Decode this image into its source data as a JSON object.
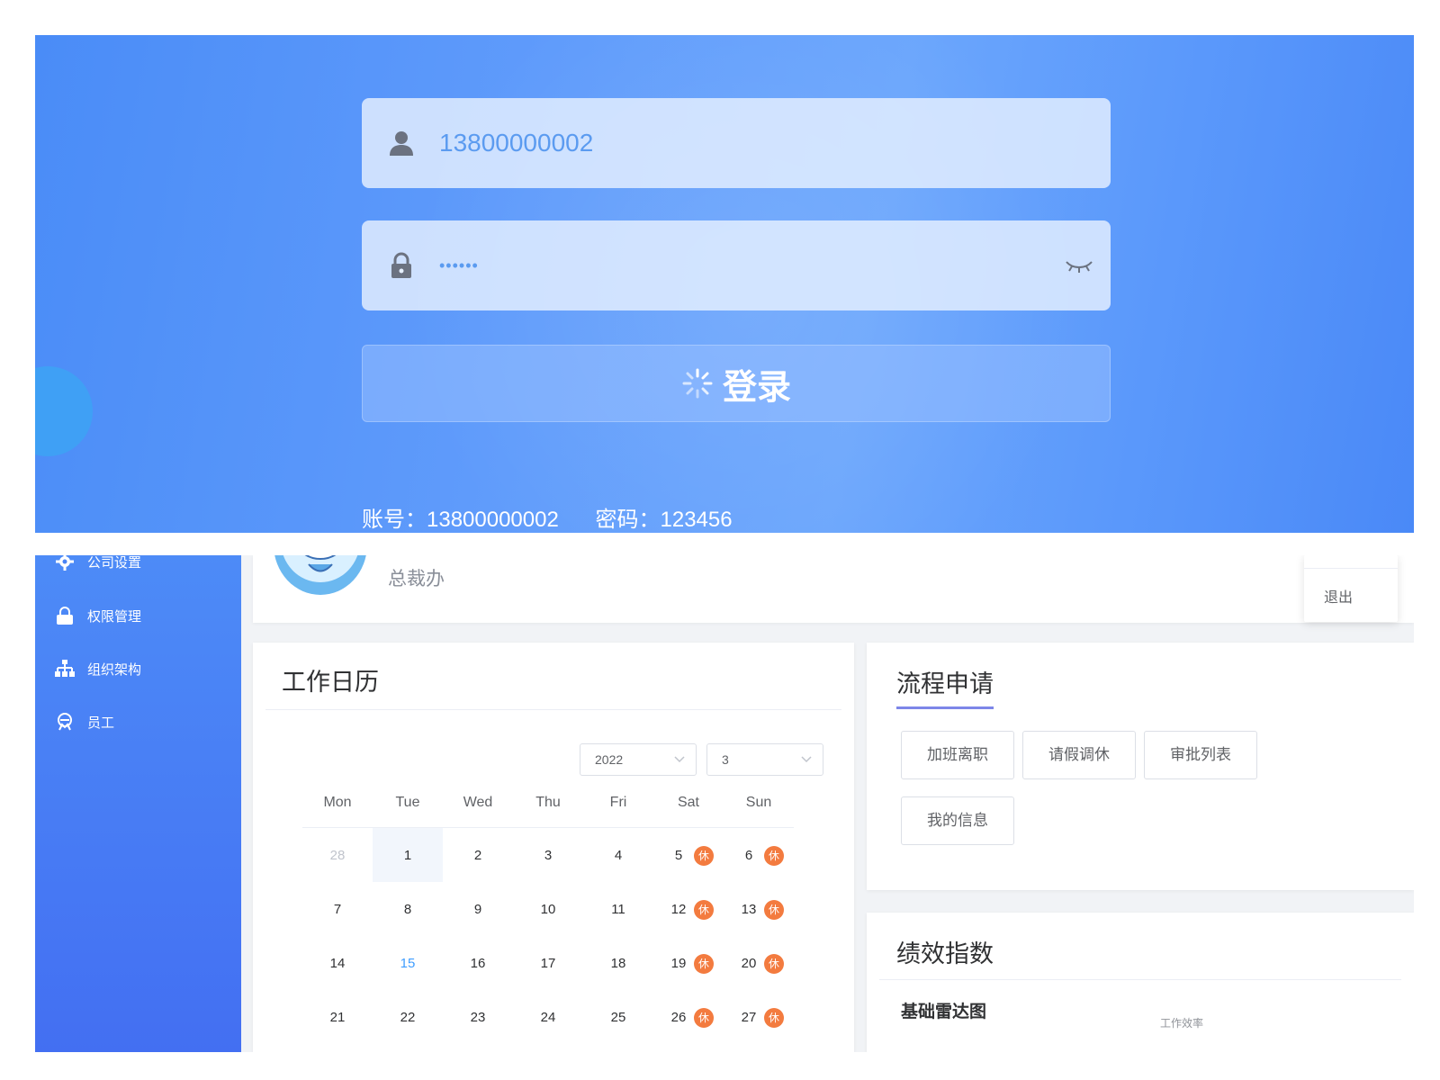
{
  "login": {
    "username_value": "13800000002",
    "password_mask": "••••••",
    "login_button_label": "登录",
    "hint_account": "账号：13800000002",
    "hint_password": "密码：123456"
  },
  "sidebar": {
    "items": [
      {
        "label": "公司设置",
        "icon": "gear-icon"
      },
      {
        "label": "权限管理",
        "icon": "lock-icon"
      },
      {
        "label": "组织架构",
        "icon": "org-chart-icon"
      },
      {
        "label": "员工",
        "icon": "employee-icon"
      }
    ]
  },
  "profile": {
    "department": "总裁办",
    "logout_label": "退出"
  },
  "calendar": {
    "title": "工作日历",
    "year": "2022",
    "month": "3",
    "weekdays": [
      "Mon",
      "Tue",
      "Wed",
      "Thu",
      "Fri",
      "Sat",
      "Sun"
    ],
    "rest_badge": "休",
    "rows": [
      [
        {
          "d": "28",
          "muted": true
        },
        {
          "d": "1",
          "selected": true
        },
        {
          "d": "2"
        },
        {
          "d": "3"
        },
        {
          "d": "4"
        },
        {
          "d": "5",
          "rest": true
        },
        {
          "d": "6",
          "rest": true
        }
      ],
      [
        {
          "d": "7"
        },
        {
          "d": "8"
        },
        {
          "d": "9"
        },
        {
          "d": "10"
        },
        {
          "d": "11"
        },
        {
          "d": "12",
          "rest": true
        },
        {
          "d": "13",
          "rest": true
        }
      ],
      [
        {
          "d": "14"
        },
        {
          "d": "15",
          "today": true
        },
        {
          "d": "16"
        },
        {
          "d": "17"
        },
        {
          "d": "18"
        },
        {
          "d": "19",
          "rest": true
        },
        {
          "d": "20",
          "rest": true
        }
      ],
      [
        {
          "d": "21"
        },
        {
          "d": "22"
        },
        {
          "d": "23"
        },
        {
          "d": "24"
        },
        {
          "d": "25"
        },
        {
          "d": "26",
          "rest": true
        },
        {
          "d": "27",
          "rest": true
        }
      ]
    ]
  },
  "flow": {
    "title": "流程申请",
    "buttons": [
      "加班离职",
      "请假调休",
      "审批列表",
      "我的信息"
    ]
  },
  "performance": {
    "title": "绩效指数",
    "subtitle": "基础雷达图",
    "radar_label": "工作效率"
  },
  "colors": {
    "brand_blue": "#4d8bf7",
    "rest_orange": "#f37b3f",
    "today_blue": "#409eff",
    "tab_underline": "#7d86e8"
  }
}
